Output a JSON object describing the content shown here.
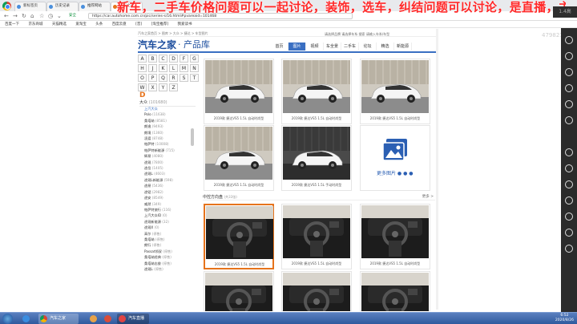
{
  "overlay_text": "新车，二手车价格问题可以一起讨论，装饰，选车，纠结问题可以讨论，是直播，主播在",
  "top_chip": "1.4高",
  "browser": {
    "tabs": [
      {
        "label": "新标签页"
      },
      {
        "label": "历史记录"
      },
      {
        "label": "推荐网站"
      },
      {
        "label": "汽车之家"
      }
    ],
    "url": "https://car.autohome.com.cn/pic/series-s/16.html#pvareaid=101468",
    "secure_label": "安全",
    "bookmarks": [
      "百度一下",
      "京东商城",
      "天猫精选",
      "爱淘宝",
      "头条",
      "百度云盘",
      "[音]",
      "[淘宝推荐]",
      "我爱读书"
    ]
  },
  "site": {
    "breadcrumb": "汽车之家首页 > 图库 > 大众 > 捷达 > 车型图片",
    "logo_main": "汽车之家",
    "logo_sub": "· 产品库",
    "search_text": "请选择品牌  请选择车系  搜索 请输入车系/车型",
    "right_number": "479821",
    "category_tabs": [
      "首页",
      "图片",
      "视频",
      "车全景",
      "二手车",
      "论坛",
      "精选",
      "新能源"
    ],
    "active_tab": "图片"
  },
  "sidebar": {
    "letters": [
      "A",
      "B",
      "C",
      "D",
      "F",
      "G",
      "H",
      "J",
      "K",
      "L",
      "M",
      "N",
      "O",
      "P",
      "Q",
      "R",
      "S",
      "T",
      "W",
      "X",
      "Y",
      "Z"
    ],
    "brand_letter": "D",
    "brand_name": "大众",
    "brand_count": "(101680)",
    "models": [
      {
        "name": "上汽大众",
        "count": "",
        "head": true
      },
      {
        "name": "Polo",
        "count": "(11638)"
      },
      {
        "name": "桑塔纳",
        "count": "(8581)"
      },
      {
        "name": "朗逸",
        "count": "(9493)"
      },
      {
        "name": "朗境",
        "count": "(1360)"
      },
      {
        "name": "凌渡",
        "count": "(8748)"
      },
      {
        "name": "帕萨特",
        "count": "(10008)"
      },
      {
        "name": "帕萨特新能源",
        "count": "(715)"
      },
      {
        "name": "辉昂",
        "count": "(4080)"
      },
      {
        "name": "途观",
        "count": "(7800)"
      },
      {
        "name": "途岳",
        "count": "(1405)"
      },
      {
        "name": "途观L",
        "count": "(4603)"
      },
      {
        "name": "途观L新能源",
        "count": "(598)"
      },
      {
        "name": "途昂",
        "count": "(5436)"
      },
      {
        "name": "途铠",
        "count": "(2982)"
      },
      {
        "name": "途安",
        "count": "(8549)"
      },
      {
        "name": "威然",
        "count": "(349)"
      },
      {
        "name": "帕萨特旅行",
        "count": "(116)"
      },
      {
        "name": "上汽大众ID",
        "count": "(0)"
      },
      {
        "name": "途观新能源",
        "count": "(32)"
      },
      {
        "name": "途观X",
        "count": "(0)"
      },
      {
        "name": "高尔",
        "count": "(停售)"
      },
      {
        "name": "桑塔纳",
        "count": "(停售)"
      },
      {
        "name": "朗行",
        "count": "(停售)"
      },
      {
        "name": "Passat领驭",
        "count": "(停售)"
      },
      {
        "name": "桑塔纳经典",
        "count": "(停售)"
      },
      {
        "name": "桑塔纳志俊",
        "count": "(停售)"
      },
      {
        "name": "途观L",
        "count": "(停售)"
      }
    ]
  },
  "gallery": {
    "exterior_captions": [
      "2019款 捷达VS5 1.5L 自动时尚型",
      "2019款 捷达VS5 1.5L 自动时尚型",
      "2019款 捷达VS5 1.5L 自动时尚型",
      "2019款 捷达VS5 1.5L 自动时尚型",
      "2019款 捷达VS5 1.5L 手动时尚型"
    ],
    "more_label": "更多图片",
    "interior_title": "中控方向盘",
    "interior_hint": "(共33张)",
    "interior_more": "更多 >",
    "interior_captions": [
      "2019款 捷达VS5 1.5L 自动时尚型",
      "2019款 捷达VS5 1.5L 自动时尚型",
      "2019款 捷达VS5 1.5L 自动时尚型"
    ]
  },
  "taskbar": {
    "tasks": [
      "汽车之家",
      "",
      "",
      "汽车直播",
      "主播直播中"
    ],
    "clock_time": "6:52",
    "clock_date": "2020/8/26"
  }
}
